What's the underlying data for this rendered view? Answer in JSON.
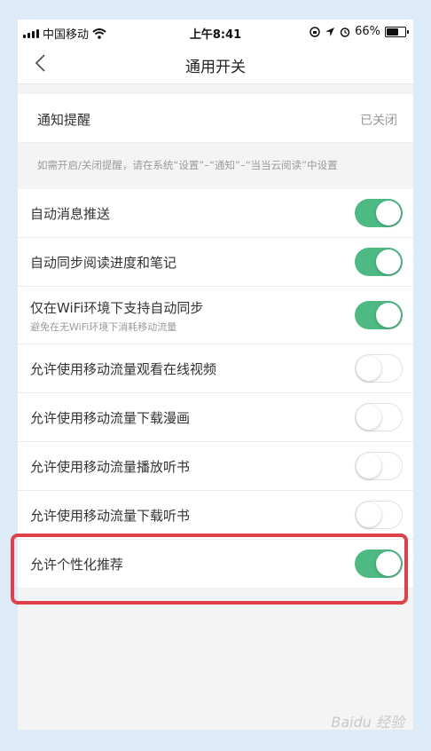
{
  "status_bar": {
    "carrier": "中国移动",
    "time": "上午8:41",
    "battery": "66%",
    "battery_level": 0.66
  },
  "nav": {
    "title": "通用开关"
  },
  "notification": {
    "label": "通知提醒",
    "value": "已关闭",
    "hint": "如需开启/关闭提醒，请在系统“设置”–“通知”–“当当云阅读”中设置"
  },
  "settings": [
    {
      "label": "自动消息推送",
      "on": true
    },
    {
      "label": "自动同步阅读进度和笔记",
      "on": true
    },
    {
      "label": "仅在WiFi环境下支持自动同步",
      "sub": "避免在无WiFi环境下消耗移动流量",
      "on": true
    },
    {
      "label": "允许使用移动流量观看在线视频",
      "on": false
    },
    {
      "label": "允许使用移动流量下载漫画",
      "on": false
    },
    {
      "label": "允许使用移动流量播放听书",
      "on": false
    },
    {
      "label": "允许使用移动流量下载听书",
      "on": false
    },
    {
      "label": "允许个性化推荐",
      "on": true
    }
  ],
  "colors": {
    "toggle_on": "#4cba82",
    "highlight": "#e0404a"
  },
  "watermark": "Baidu 经验"
}
